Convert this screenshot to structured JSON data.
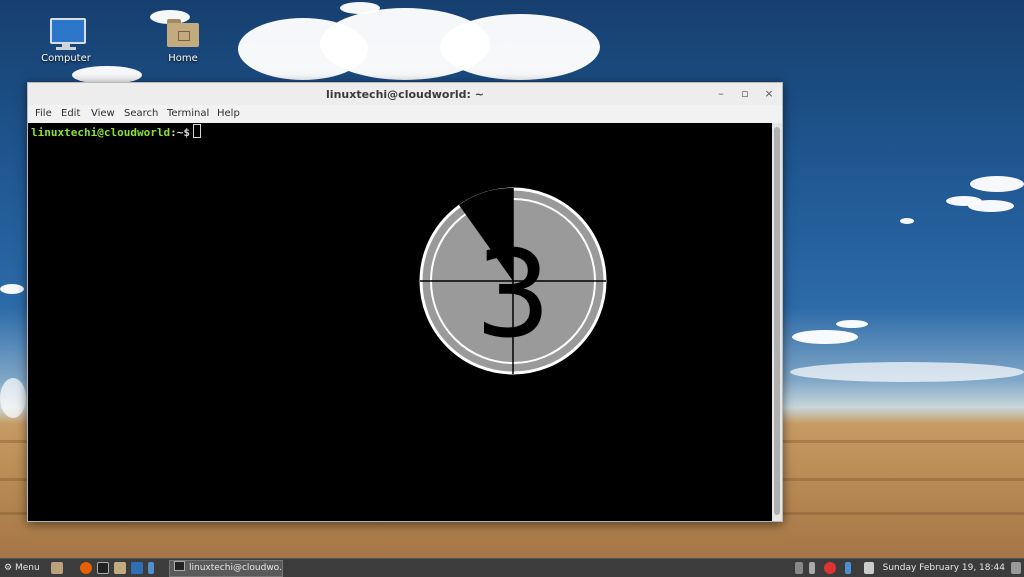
{
  "desktop": {
    "icons": [
      {
        "label": "Computer",
        "icon": "computer-icon"
      },
      {
        "label": "Home",
        "icon": "home-folder-icon"
      }
    ]
  },
  "window": {
    "title": "linuxtechi@cloudworld: ~",
    "controls": {
      "minimize": "–",
      "maximize": "▫",
      "close": "×"
    },
    "menu": [
      "File",
      "Edit",
      "View",
      "Search",
      "Terminal",
      "Help"
    ]
  },
  "terminal": {
    "user_host": "linuxtechi@cloudworld",
    "path": ":~$",
    "countdown_digit": "3"
  },
  "taskbar": {
    "menu_label": "Menu",
    "task_title": "linuxtechi@cloudwo...",
    "clock": "Sunday February 19, 18:44"
  },
  "colors": {
    "prompt_user": "#8ae234",
    "terminal_bg": "#000000",
    "taskbar_bg": "#3c3c3c"
  }
}
